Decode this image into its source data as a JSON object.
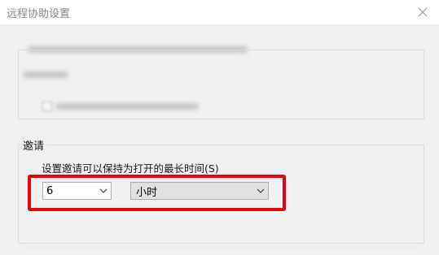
{
  "window": {
    "title": "远程协助设置"
  },
  "invitations": {
    "group_label": "邀请",
    "duration_label": "设置邀请可以保持为打开的最长时间(S)",
    "duration_value": "6",
    "duration_unit": "小时"
  },
  "icons": {
    "close": "close-icon",
    "dropdown": "chevron-down-icon"
  },
  "colors": {
    "highlight": "#e60012",
    "dialog_background": "#f0f0f0"
  }
}
